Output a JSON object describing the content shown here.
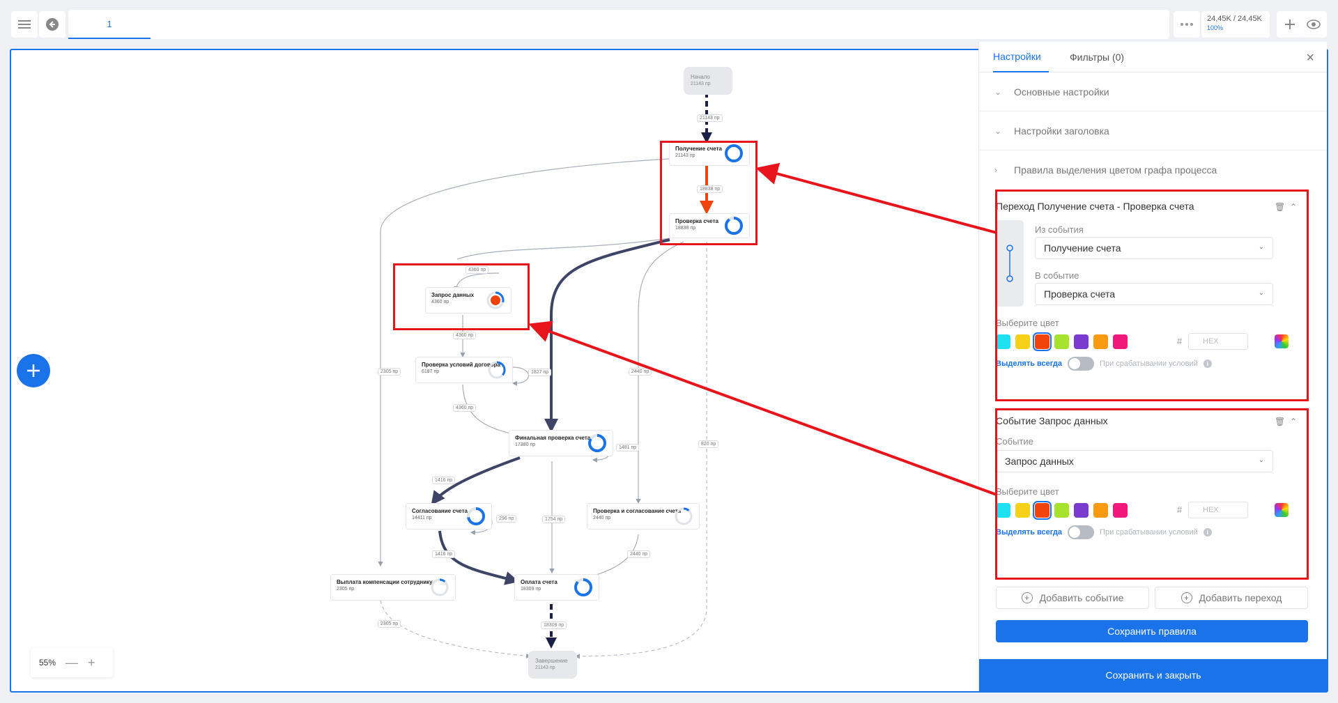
{
  "topbar": {
    "menu_icon": "hamburger-menu-icon",
    "back_icon": "back-arrow-icon",
    "tab_label": "1",
    "more_icon": "more-dots-icon",
    "stats_main": "24,45K / 24,45K",
    "stats_sub": "100%",
    "add_icon": "plus-icon",
    "view_icon": "eye-icon"
  },
  "graph": {
    "nodes": {
      "start": {
        "title": "Начало",
        "count": "21143 пр"
      },
      "receive": {
        "title": "Получение счета",
        "count": "21143 пр"
      },
      "check": {
        "title": "Проверка счета",
        "count": "18838 пр"
      },
      "request": {
        "title": "Запрос данных",
        "count": "4360 пр"
      },
      "contract": {
        "title": "Проверка условий договора",
        "count": "6187 пр"
      },
      "final": {
        "title": "Финальная проверка счета",
        "count": "17380 пр"
      },
      "approve": {
        "title": "Согласование счета",
        "count": "14411 пр"
      },
      "check_approve": {
        "title": "Проверка и согласование счета",
        "count": "2440 пр"
      },
      "payout": {
        "title": "Выплата компенсации сотруднику",
        "count": "2305 пр"
      },
      "pay": {
        "title": "Оплата счета",
        "count": "18309 пр"
      },
      "end": {
        "title": "Завершение",
        "count": "21143 пр"
      }
    },
    "edges": {
      "e1": "21143 пр",
      "e2": "18838 пр",
      "e3": "4360 пр",
      "e4": "4360 пр",
      "e5": "1827 пр",
      "e6": "4360 пр",
      "e7": "1481 пр",
      "e8": "1416 пр",
      "e9": "296 пр",
      "e10": "1754 пр",
      "e11": "1416 пр",
      "e12": "2440 пр",
      "e13": "2440 пр",
      "e14": "2305 пр",
      "e15": "2305 пр",
      "e16": "18309 пр",
      "e17": "820 пр"
    }
  },
  "zoom": {
    "level": "55%",
    "minus": "—",
    "plus": "+"
  },
  "panel": {
    "tabs": [
      "Настройки",
      "Фильтры (0)"
    ],
    "close": "×",
    "sections": [
      "Основные настройки",
      "Настройки заголовка",
      "Правила выделения цветом графа процесса"
    ],
    "rule1": {
      "title": "Переход Получение счета - Проверка счета",
      "from_label": "Из события",
      "from_value": "Получение счета",
      "to_label": "В событие",
      "to_value": "Проверка счета",
      "color_label": "Выберите цвет",
      "hex_hash": "#",
      "hex_placeholder": "HEX",
      "always_label": "Выделять всегда",
      "condition_label": "При срабатывании условий"
    },
    "rule2": {
      "title": "Событие Запрос данных",
      "event_label": "Событие",
      "event_value": "Запрос данных",
      "color_label": "Выберите цвет",
      "hex_hash": "#",
      "hex_placeholder": "HEX",
      "always_label": "Выделять всегда",
      "condition_label": "При срабатывании условий"
    },
    "add_event": "Добавить событие",
    "add_transition": "Добавить переход",
    "save_rules": "Сохранить правила",
    "save_close": "Сохранить и закрыть",
    "palette": [
      "#1ee0f0",
      "#f7d117",
      "#f0440c",
      "#a6e22e",
      "#7a3ccf",
      "#f99a12",
      "#f0187a"
    ],
    "selected_color": "#f0440c",
    "accent": "#1a73e8"
  }
}
